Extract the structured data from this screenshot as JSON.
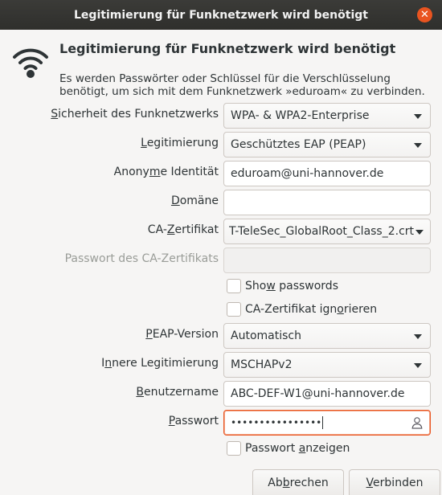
{
  "window": {
    "title": "Legitimierung für Funknetzwerk wird benötigt"
  },
  "dialog": {
    "heading": "Legitimierung für Funknetzwerk wird benötigt",
    "message_line1": "Es werden Passwörter oder Schlüssel für die Verschlüsselung",
    "message_line2": "benötigt, um sich mit dem Funknetzwerk »eduroam« zu verbinden."
  },
  "form": {
    "security": {
      "label_pre": "",
      "label_mnemonic": "S",
      "label_post": "icherheit des Funknetzwerks",
      "value": "WPA- & WPA2-Enterprise"
    },
    "authentication": {
      "label_pre": "",
      "label_mnemonic": "L",
      "label_post": "egitimierung",
      "value": "Geschütztes EAP (PEAP)"
    },
    "anonymous_identity": {
      "label_pre": "Anony",
      "label_mnemonic": "m",
      "label_post": "e Identität",
      "value": "eduroam@uni-hannover.de"
    },
    "domain": {
      "label_pre": "",
      "label_mnemonic": "D",
      "label_post": "omäne",
      "value": ""
    },
    "ca_certificate": {
      "label_pre": "CA-",
      "label_mnemonic": "Z",
      "label_post": "ertifikat",
      "value": "T-TeleSec_GlobalRoot_Class_2.crt"
    },
    "ca_password": {
      "label": "Passwort des CA-Zertifikats",
      "value": ""
    },
    "show_passwords": {
      "label_pre": "Sho",
      "label_mnemonic": "w",
      "label_post": " passwords",
      "checked": false
    },
    "ignore_ca": {
      "label_pre": "CA-Zertifikat ign",
      "label_mnemonic": "o",
      "label_post": "rieren",
      "checked": false
    },
    "peap_version": {
      "label_pre": "",
      "label_mnemonic": "P",
      "label_post": "EAP-Version",
      "value": "Automatisch"
    },
    "inner_auth": {
      "label_pre": "I",
      "label_mnemonic": "n",
      "label_post": "nere Legitimierung",
      "value": "MSCHAPv2"
    },
    "username": {
      "label_pre": "",
      "label_mnemonic": "B",
      "label_post": "enutzername",
      "value": "ABC-DEF-W1@uni-hannover.de"
    },
    "password": {
      "label_pre": "",
      "label_mnemonic": "P",
      "label_post": "asswort",
      "value": "••••••••••••••••"
    },
    "show_password": {
      "label_pre": "Passwort ",
      "label_mnemonic": "a",
      "label_post": "nzeigen",
      "checked": false
    }
  },
  "buttons": {
    "cancel": {
      "pre": "Ab",
      "mnemonic": "b",
      "post": "rechen"
    },
    "connect": {
      "pre": "",
      "mnemonic": "V",
      "post": "erbinden"
    }
  },
  "icons": {
    "header": "wifi-icon",
    "close": "close-icon",
    "password_owner": "person-icon"
  },
  "colors": {
    "accent": "#e95420",
    "titlebar": "#2f2f2c",
    "background": "#f6f5f4"
  }
}
